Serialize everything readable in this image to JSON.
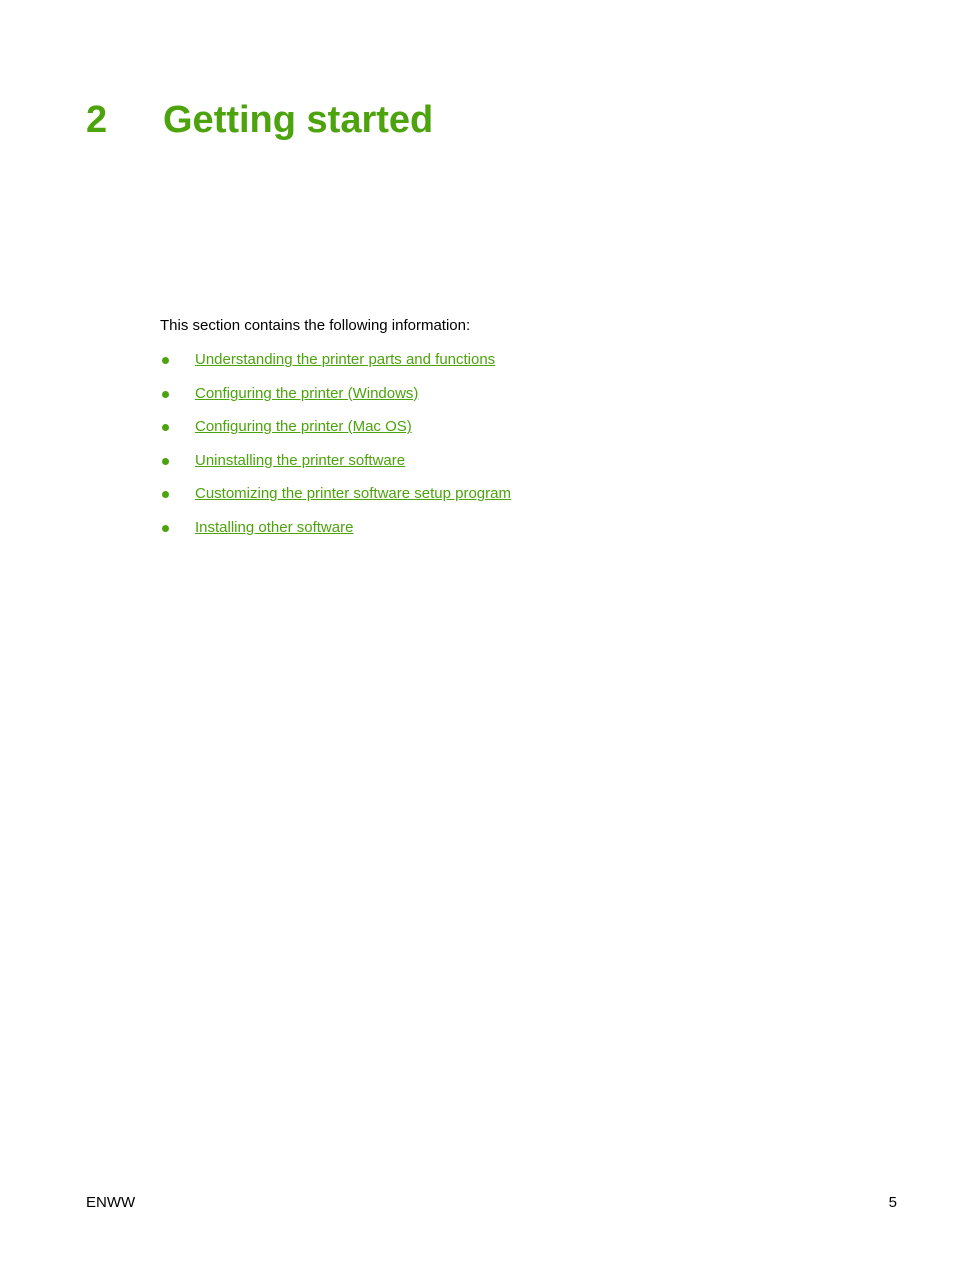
{
  "chapter": {
    "number": "2",
    "title": "Getting started"
  },
  "intro": "This section contains the following information:",
  "toc": [
    {
      "label": "Understanding the printer parts and functions"
    },
    {
      "label": "Configuring the printer (Windows)"
    },
    {
      "label": "Configuring the printer (Mac OS)"
    },
    {
      "label": "Uninstalling the printer software"
    },
    {
      "label": "Customizing the printer software setup program"
    },
    {
      "label": "Installing other software"
    }
  ],
  "footer": {
    "left": "ENWW",
    "page_number": "5"
  },
  "colors": {
    "accent": "#4ca30d",
    "text": "#000000"
  }
}
